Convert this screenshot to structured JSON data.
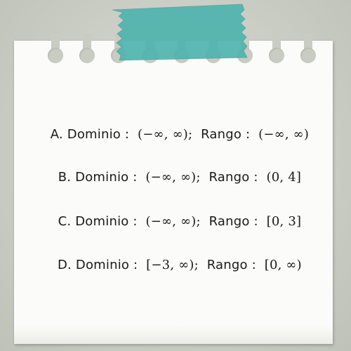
{
  "options": [
    {
      "letter": "A.",
      "domain_label": "Dominio :",
      "domain": "(−∞, ∞);",
      "range_label": "Rango :",
      "range": "(−∞, ∞)"
    },
    {
      "letter": "B.",
      "domain_label": "Dominio :",
      "domain": "(−∞, ∞);",
      "range_label": "Rango :",
      "range": "(0, 4]"
    },
    {
      "letter": "C.",
      "domain_label": "Dominio :",
      "domain": "(−∞, ∞);",
      "range_label": "Rango :",
      "range": "[0, 3]"
    },
    {
      "letter": "D.",
      "domain_label": "Dominio :",
      "domain": "[−3, ∞);",
      "range_label": "Rango :",
      "range": "[0, ∞)"
    }
  ],
  "colors": {
    "background": "#c9ccc3",
    "paper": "#fbfbf9",
    "tape": "#4fb3ad",
    "text": "#1a1a1a"
  }
}
